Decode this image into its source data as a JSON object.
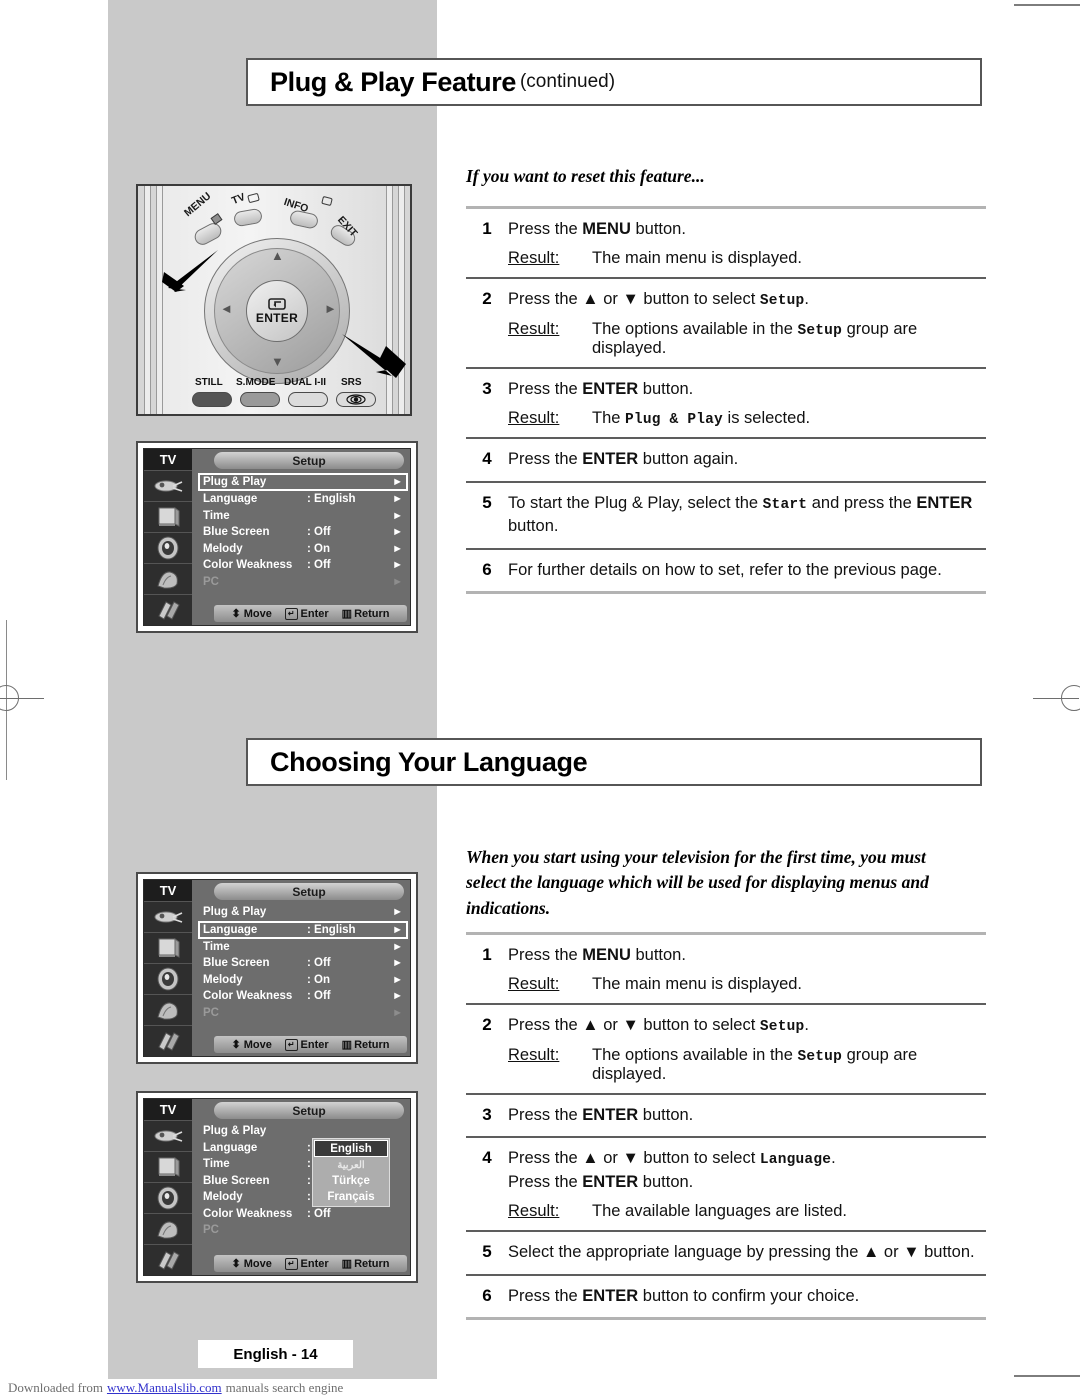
{
  "page": {
    "footer_badge": "English - 14",
    "download_prefix": "Downloaded from",
    "download_link": "www.Manualslib.com",
    "download_suffix": "manuals search engine"
  },
  "section1": {
    "title_main": "Plug & Play Feature",
    "title_sub": "(continued)",
    "intro": "If you want to reset this feature...",
    "steps": [
      {
        "num": "1",
        "lines": [
          {
            "parts": [
              {
                "t": "Press the ",
                "s": "n"
              },
              {
                "t": "MENU",
                "s": "b"
              },
              {
                "t": " button.",
                "s": "n"
              }
            ]
          }
        ],
        "result_label": "Result:",
        "result": "The main menu is displayed."
      },
      {
        "num": "2",
        "lines": [
          {
            "parts": [
              {
                "t": "Press the ",
                "s": "n"
              },
              {
                "t": "▲",
                "s": "b"
              },
              {
                "t": " or ",
                "s": "n"
              },
              {
                "t": "▼",
                "s": "b"
              },
              {
                "t": " button to select ",
                "s": "n"
              },
              {
                "t": "Setup",
                "s": "m"
              },
              {
                "t": ".",
                "s": "n"
              }
            ]
          }
        ],
        "result_label": "Result:",
        "result_parts": [
          {
            "t": "The options available in the ",
            "s": "n"
          },
          {
            "t": "Setup",
            "s": "m"
          },
          {
            "t": " group are displayed.",
            "s": "n"
          }
        ]
      },
      {
        "num": "3",
        "lines": [
          {
            "parts": [
              {
                "t": "Press the ",
                "s": "n"
              },
              {
                "t": "ENTER",
                "s": "b"
              },
              {
                "t": " button.",
                "s": "n"
              }
            ]
          }
        ],
        "result_label": "Result:",
        "result_parts": [
          {
            "t": "The ",
            "s": "n"
          },
          {
            "t": "Plug & Play",
            "s": "m"
          },
          {
            "t": " is selected.",
            "s": "n"
          }
        ]
      },
      {
        "num": "4",
        "lines": [
          {
            "parts": [
              {
                "t": "Press the ",
                "s": "n"
              },
              {
                "t": "ENTER",
                "s": "b"
              },
              {
                "t": " button again.",
                "s": "n"
              }
            ]
          }
        ]
      },
      {
        "num": "5",
        "lines": [
          {
            "parts": [
              {
                "t": "To start the Plug & Play, select the ",
                "s": "n"
              },
              {
                "t": "Start",
                "s": "m"
              },
              {
                "t": " and press the ",
                "s": "n"
              },
              {
                "t": "ENTER",
                "s": "b"
              },
              {
                "t": " button.",
                "s": "n"
              }
            ]
          }
        ]
      },
      {
        "num": "6",
        "lines": [
          {
            "parts": [
              {
                "t": "For further details on how to set, refer to the previous page.",
                "s": "n"
              }
            ]
          }
        ]
      }
    ]
  },
  "section2": {
    "title_main": "Choosing Your Language",
    "title_sub": "",
    "intro": "When you start using your television for the first time, you must select the language which will be used for displaying menus and indications.",
    "steps": [
      {
        "num": "1",
        "lines": [
          {
            "parts": [
              {
                "t": "Press the ",
                "s": "n"
              },
              {
                "t": "MENU",
                "s": "b"
              },
              {
                "t": " button.",
                "s": "n"
              }
            ]
          }
        ],
        "result_label": "Result:",
        "result": "The main menu is displayed."
      },
      {
        "num": "2",
        "lines": [
          {
            "parts": [
              {
                "t": "Press the ",
                "s": "n"
              },
              {
                "t": "▲",
                "s": "b"
              },
              {
                "t": " or ",
                "s": "n"
              },
              {
                "t": "▼",
                "s": "b"
              },
              {
                "t": " button to select ",
                "s": "n"
              },
              {
                "t": "Setup",
                "s": "m"
              },
              {
                "t": ".",
                "s": "n"
              }
            ]
          }
        ],
        "result_label": "Result:",
        "result_parts": [
          {
            "t": "The options available in the ",
            "s": "n"
          },
          {
            "t": "Setup",
            "s": "m"
          },
          {
            "t": " group are displayed.",
            "s": "n"
          }
        ]
      },
      {
        "num": "3",
        "lines": [
          {
            "parts": [
              {
                "t": "Press the ",
                "s": "n"
              },
              {
                "t": "ENTER",
                "s": "b"
              },
              {
                "t": " button.",
                "s": "n"
              }
            ]
          }
        ]
      },
      {
        "num": "4",
        "lines": [
          {
            "parts": [
              {
                "t": "Press the ",
                "s": "n"
              },
              {
                "t": "▲",
                "s": "b"
              },
              {
                "t": " or ",
                "s": "n"
              },
              {
                "t": "▼",
                "s": "b"
              },
              {
                "t": " button to select ",
                "s": "n"
              },
              {
                "t": "Language",
                "s": "m"
              },
              {
                "t": ".",
                "s": "n"
              }
            ]
          },
          {
            "parts": [
              {
                "t": "Press the ",
                "s": "n"
              },
              {
                "t": "ENTER",
                "s": "b"
              },
              {
                "t": " button.",
                "s": "n"
              }
            ]
          }
        ],
        "result_label": "Result:",
        "result": "The available languages are listed."
      },
      {
        "num": "5",
        "lines": [
          {
            "parts": [
              {
                "t": "Select the appropriate language by pressing the ",
                "s": "n"
              },
              {
                "t": "▲",
                "s": "b"
              },
              {
                "t": " or ",
                "s": "n"
              },
              {
                "t": "▼",
                "s": "b"
              },
              {
                "t": " button.",
                "s": "n"
              }
            ]
          }
        ]
      },
      {
        "num": "6",
        "lines": [
          {
            "parts": [
              {
                "t": "Press the ",
                "s": "n"
              },
              {
                "t": "ENTER",
                "s": "b"
              },
              {
                "t": " button to confirm your choice.",
                "s": "n"
              }
            ]
          }
        ]
      }
    ]
  },
  "remote": {
    "buttons_top": [
      {
        "name": "MENU",
        "label": "MENU"
      },
      {
        "name": "TV",
        "label": "TV"
      },
      {
        "name": "INFO",
        "label": "INFO"
      },
      {
        "name": "EXIT",
        "label": "EXIT"
      }
    ],
    "enter_label": "ENTER",
    "buttons_bottom": [
      {
        "name": "STILL",
        "label": "STILL"
      },
      {
        "name": "S.MODE",
        "label": "S.MODE"
      },
      {
        "name": "DUAL",
        "label": "DUAL I-II"
      },
      {
        "name": "SRS",
        "label": "SRS"
      }
    ]
  },
  "osd": {
    "tv_label": "TV",
    "title": "Setup",
    "footer": {
      "move": "Move",
      "enter": "Enter",
      "return": "Return"
    },
    "rows": [
      {
        "label": "Plug & Play",
        "value": "",
        "arrow": "►"
      },
      {
        "label": "Language",
        "value": ": English",
        "arrow": "►"
      },
      {
        "label": "Time",
        "value": "",
        "arrow": "►"
      },
      {
        "label": "Blue Screen",
        "value": ": Off",
        "arrow": "►"
      },
      {
        "label": "Melody",
        "value": ": On",
        "arrow": "►"
      },
      {
        "label": "Color Weakness",
        "value": ": Off",
        "arrow": "►"
      },
      {
        "label": "PC",
        "value": "",
        "arrow": "►"
      }
    ],
    "languages": [
      "English",
      "العربية",
      "Türkçe",
      "Français"
    ],
    "selected_language": "English"
  },
  "colors": {
    "panel_gray": "#c9c9c9",
    "header_border": "#565656",
    "osd_bg": "#6d6d6d",
    "link_blue": "#3333cc"
  }
}
